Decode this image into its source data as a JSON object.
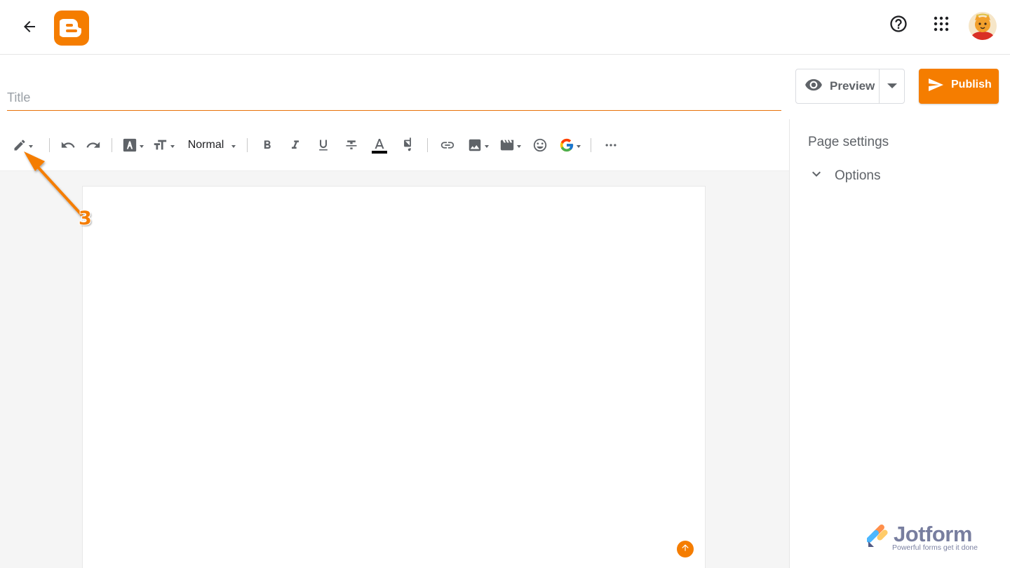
{
  "app": {
    "brand_color": "#f57d00",
    "accent_line": "#e8710a",
    "icon_gray": "#5f6368"
  },
  "header": {
    "back_icon": "arrow-left-icon",
    "logo_icon": "blogger-logo-icon",
    "help_icon": "help-circle-icon",
    "apps_icon": "apps-grid-icon",
    "avatar_icon": "cartoon-avatar"
  },
  "editor": {
    "title_placeholder": "Title",
    "preview_label": "Preview",
    "publish_label": "Publish"
  },
  "toolbar": {
    "mode_icon": "pencil-icon",
    "undo_icon": "undo-icon",
    "redo_icon": "redo-icon",
    "font_icon": "font-icon",
    "font_size_icon": "font-size-icon",
    "paragraph_style": "Normal",
    "bold_icon": "bold-icon",
    "italic_icon": "italic-icon",
    "underline_icon": "underline-icon",
    "strikethrough_icon": "strikethrough-icon",
    "text_color_icon": "text-color-icon",
    "highlight_icon": "highlight-icon",
    "link_icon": "link-icon",
    "image_icon": "image-icon",
    "video_icon": "video-icon",
    "emoji_icon": "emoji-icon",
    "google_icon": "google-icon",
    "more_icon": "more-horizontal-icon"
  },
  "side_panel": {
    "heading": "Page settings",
    "options_label": "Options"
  },
  "annotation": {
    "step_number": "3"
  },
  "watermark": {
    "name": "Jotform",
    "tagline": "Powerful forms get it done"
  }
}
